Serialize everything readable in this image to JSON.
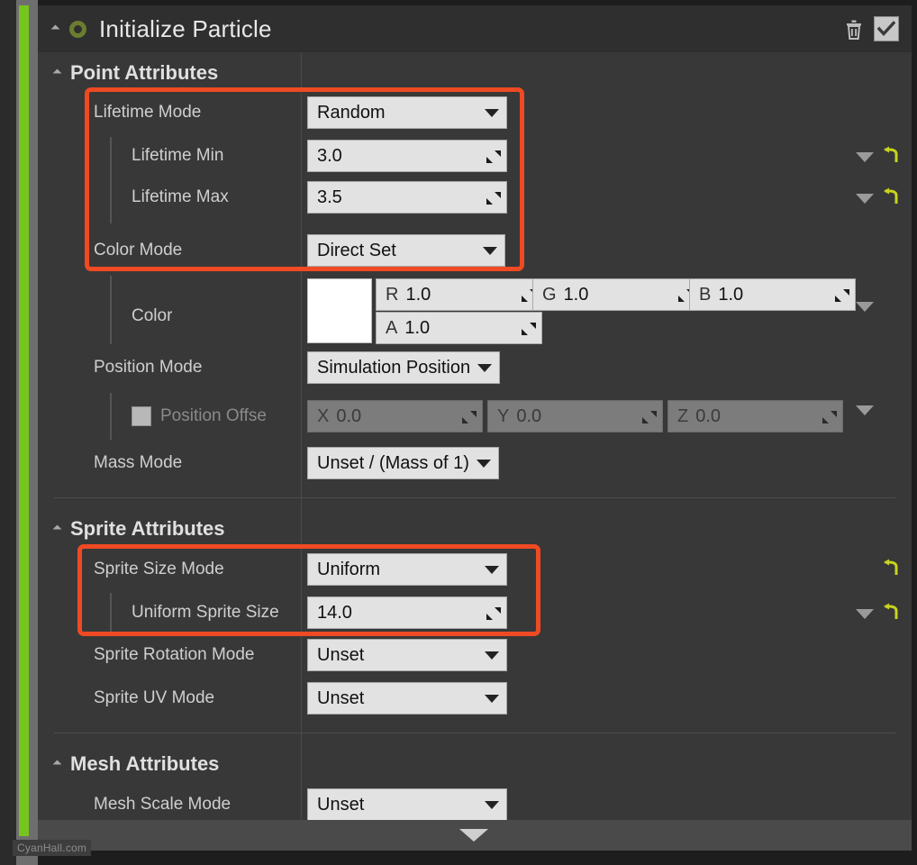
{
  "module": {
    "title": "Initialize Particle",
    "collapse_icon": "triangle-collapse-icon",
    "status_icon": "green-ring-icon",
    "delete_icon": "trash-icon",
    "enabled_icon": "checkmark-icon",
    "enabled": true
  },
  "sections": [
    {
      "label": "Point Attributes"
    },
    {
      "label": "Sprite Attributes"
    },
    {
      "label": "Mesh Attributes"
    }
  ],
  "point_attributes": {
    "lifetime_mode": {
      "label": "Lifetime Mode",
      "value": "Random"
    },
    "lifetime_min": {
      "label": "Lifetime Min",
      "value": "3.0"
    },
    "lifetime_max": {
      "label": "Lifetime Max",
      "value": "3.5"
    },
    "color_mode": {
      "label": "Color Mode",
      "value": "Direct Set"
    },
    "color": {
      "label": "Color",
      "swatch_hex": "#ffffff",
      "r": {
        "axis": "R",
        "value": "1.0"
      },
      "g": {
        "axis": "G",
        "value": "1.0"
      },
      "b": {
        "axis": "B",
        "value": "1.0"
      },
      "a": {
        "axis": "A",
        "value": "1.0"
      }
    },
    "position_mode": {
      "label": "Position Mode",
      "value": "Simulation Position"
    },
    "position_offset": {
      "label": "Position Offse",
      "checked": false,
      "x": {
        "axis": "X",
        "value": "0.0"
      },
      "y": {
        "axis": "Y",
        "value": "0.0"
      },
      "z": {
        "axis": "Z",
        "value": "0.0"
      }
    },
    "mass_mode": {
      "label": "Mass Mode",
      "value": "Unset / (Mass of 1)"
    }
  },
  "sprite_attributes": {
    "sprite_size_mode": {
      "label": "Sprite Size Mode",
      "value": "Uniform"
    },
    "uniform_sprite_size": {
      "label": "Uniform Sprite Size",
      "value": "14.0"
    },
    "sprite_rotation_mode": {
      "label": "Sprite Rotation Mode",
      "value": "Unset"
    },
    "sprite_uv_mode": {
      "label": "Sprite UV Mode",
      "value": "Unset"
    }
  },
  "mesh_attributes": {
    "mesh_scale_mode": {
      "label": "Mesh Scale Mode",
      "value": "Unset"
    }
  },
  "icons": {
    "reset": "reset-arrow-icon",
    "expand": "chevron-down-icon",
    "drag": "drag-handle-icon",
    "bottom_expander": "expander-arrow-icon"
  },
  "colors": {
    "highlight": "#ef4a23",
    "accent_bar": "#76c41e",
    "reset_arrow": "#c7d420",
    "panel_bg": "#383838"
  },
  "watermark": {
    "text": "CyanHall.com"
  }
}
